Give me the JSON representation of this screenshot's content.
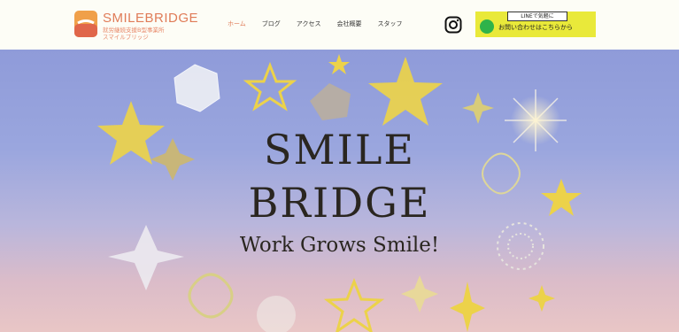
{
  "brand": {
    "name": "SMILEBRIDGE",
    "subtitle_line1": "就労継続支援B型事業所",
    "subtitle_line2": "スマイルブリッジ"
  },
  "nav": {
    "items": [
      {
        "label": "ホーム",
        "active": true
      },
      {
        "label": "ブログ"
      },
      {
        "label": "アクセス"
      },
      {
        "label": "会社概要"
      },
      {
        "label": "スタッフ"
      }
    ]
  },
  "line_banner": {
    "tag": "LINEで気軽に",
    "text": "お問い合わせはこちらから",
    "color": "#e9e93a"
  },
  "hero": {
    "line1": "SMILE",
    "line2": "BRIDGE",
    "tagline": "Work Grows Smile!"
  },
  "colors": {
    "brand": "#e07c58",
    "line_green": "#2fb34a",
    "star_yellow": "#ecd24a"
  }
}
